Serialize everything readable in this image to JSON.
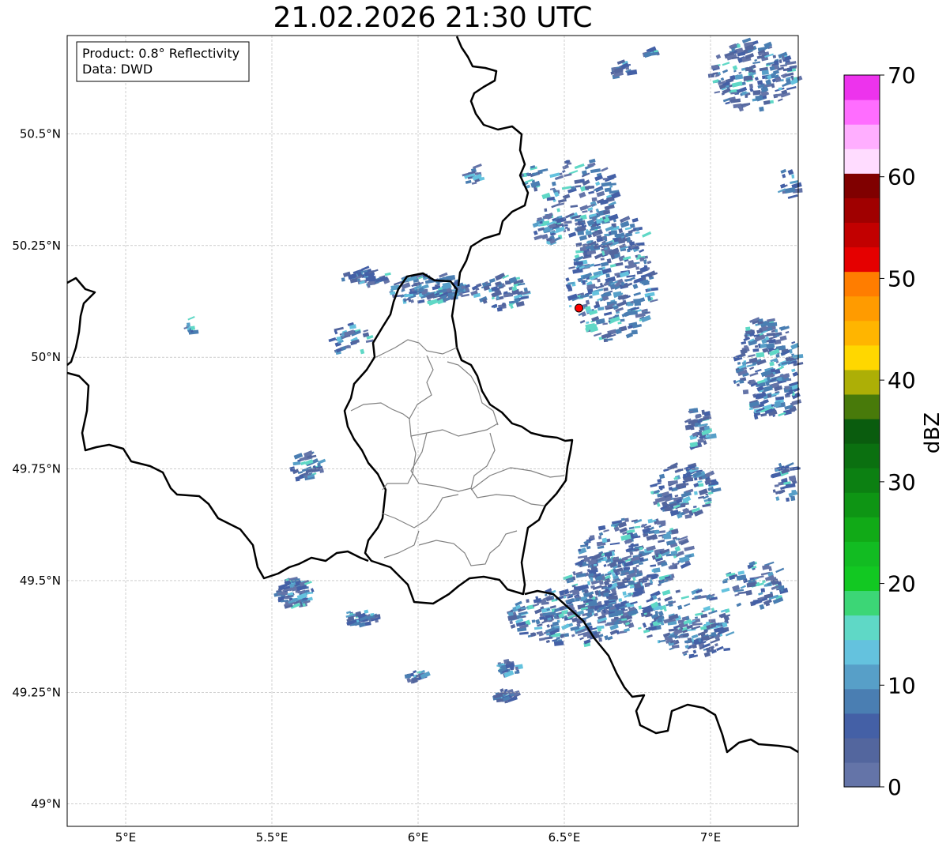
{
  "title": "21.02.2026 21:30 UTC",
  "info": {
    "product": "Product: 0.8° Reflectivity",
    "data": "Data: DWD"
  },
  "map": {
    "lon_range": [
      4.8,
      7.3
    ],
    "lat_range": [
      48.95,
      50.72
    ],
    "lat_ticks": [
      {
        "value": 50.5,
        "label": "50.5°N"
      },
      {
        "value": 50.25,
        "label": "50.25°N"
      },
      {
        "value": 50.0,
        "label": "50°N"
      },
      {
        "value": 49.75,
        "label": "49.75°N"
      },
      {
        "value": 49.5,
        "label": "49.5°N"
      },
      {
        "value": 49.25,
        "label": "49.25°N"
      },
      {
        "value": 49.0,
        "label": "49°N"
      }
    ],
    "lon_ticks": [
      {
        "value": 5.0,
        "label": "5°E"
      },
      {
        "value": 5.5,
        "label": "5.5°E"
      },
      {
        "value": 6.0,
        "label": "6°E"
      },
      {
        "value": 6.5,
        "label": "6.5°E"
      },
      {
        "value": 7.0,
        "label": "7°E"
      }
    ],
    "radar_site": {
      "lon": 6.55,
      "lat": 50.11,
      "color": "#ff0000"
    },
    "gridlines": true
  },
  "colorbar": {
    "label": "dBZ",
    "min": 0,
    "max": 70,
    "ticks": [
      0,
      10,
      20,
      30,
      40,
      50,
      60,
      70
    ],
    "colors": [
      "#6474a8",
      "#53669e",
      "#4460a6",
      "#4a7eb2",
      "#579fc8",
      "#64c2de",
      "#5fd8c6",
      "#3cd676",
      "#12c822",
      "#12bc22",
      "#11aa17",
      "#0e9514",
      "#0c8012",
      "#0b7010",
      "#0a5c0e",
      "#487a0a",
      "#adaf06",
      "#ffd700",
      "#ffb500",
      "#ff9b00",
      "#ff7d00",
      "#e50000",
      "#c20000",
      "#a00000",
      "#800000",
      "#ffdcff",
      "#ffaeff",
      "#ff6dff",
      "#ed33ed"
    ]
  }
}
